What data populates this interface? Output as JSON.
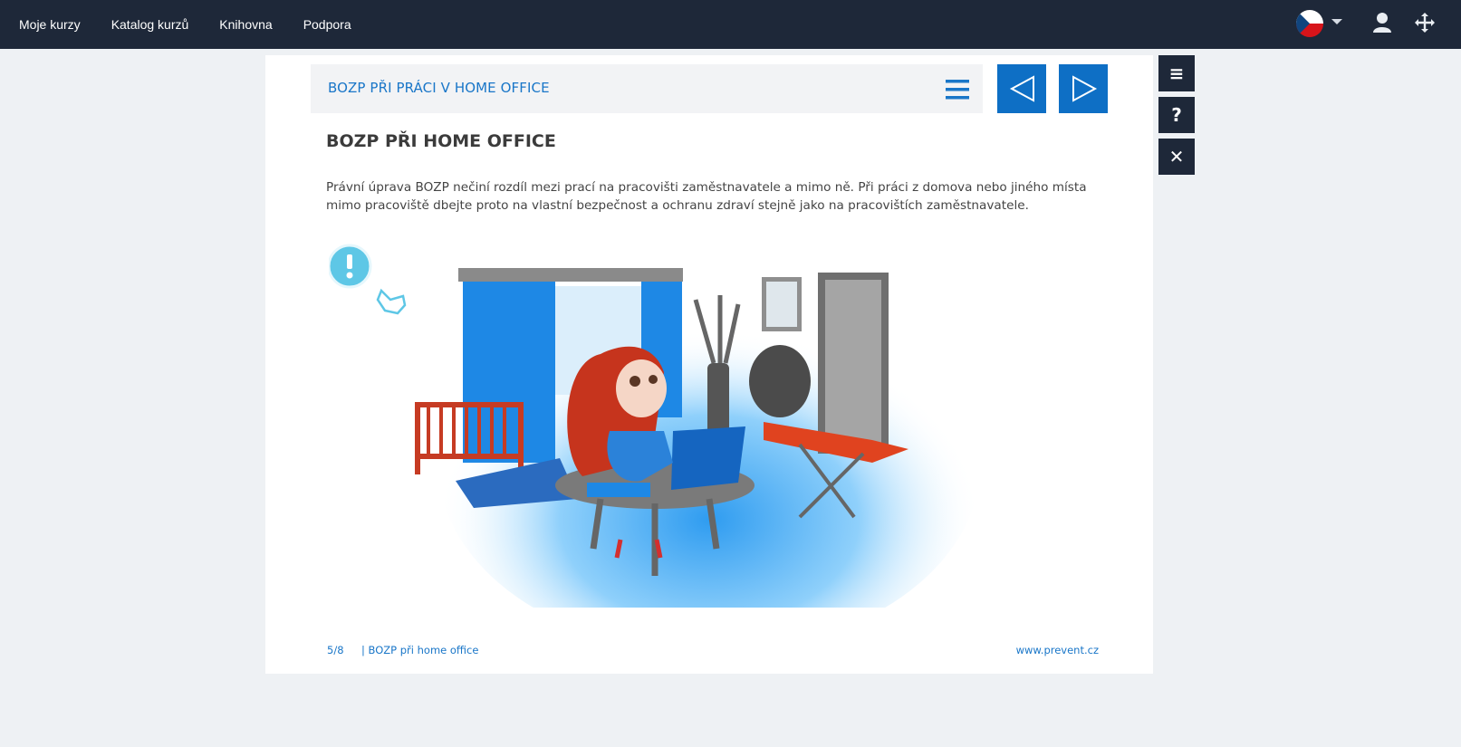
{
  "topnav": {
    "links": [
      "Moje kurzy",
      "Katalog kurzů",
      "Knihovna",
      "Podpora"
    ],
    "language_flag": "cz-flag-icon",
    "icons": [
      "chevron-down-icon",
      "user-icon",
      "move-icon"
    ]
  },
  "lesson": {
    "bar_title": "BOZP PŘI PRÁCI V HOME OFFICE",
    "heading": "BOZP PŘI HOME OFFICE",
    "paragraph": "Právní úprava BOZP nečiní rozdíl mezi prací na pracovišti zaměstnavatele a mimo ně. Při práci z domova nebo jiného místa mimo pracoviště dbejte proto na vlastní bezpečnost a ochranu zdraví stejně jako na pracovištích zaměstnavatele.",
    "hotspot_icon": "exclamation-hotspot-icon"
  },
  "footer": {
    "page": "5/8",
    "section": "| BOZP při home office",
    "website": "www.prevent.cz"
  },
  "side_toolbar": {
    "menu_icon": "≡",
    "help_icon": "?",
    "close_icon": "✕"
  },
  "colors": {
    "nav_bg": "#1e2839",
    "accent_blue": "#0e6fc5",
    "text_blue": "#1976c8",
    "page_bg": "#eef1f4"
  }
}
